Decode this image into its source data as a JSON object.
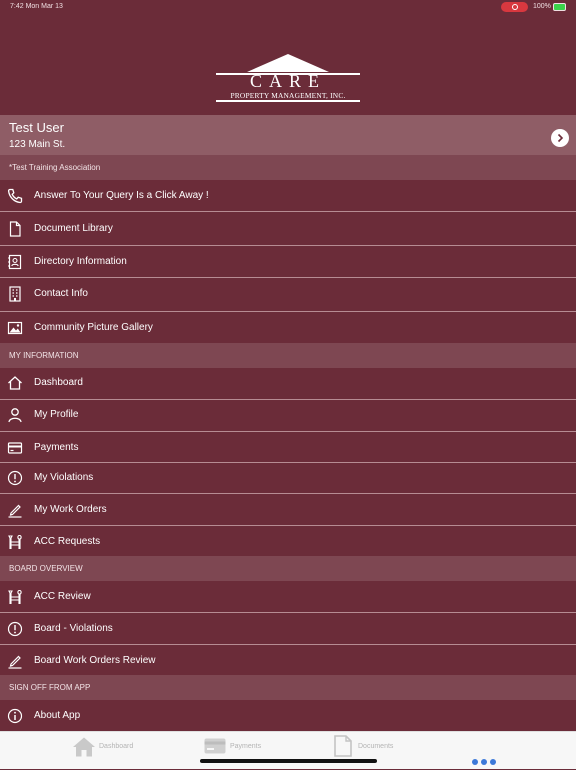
{
  "status": {
    "time": "7:42  Mon Mar 13",
    "battery": "100%"
  },
  "logo": {
    "title": "CARE",
    "subtitle": "PROPERTY MANAGEMENT, INC."
  },
  "user": {
    "name": "Test User",
    "address": "123 Main St."
  },
  "association": "*Test Training Association",
  "menu_top": [
    {
      "label": "Answer To Your Query Is a Click Away !",
      "icon": "phone-icon"
    },
    {
      "label": "Document Library",
      "icon": "document-icon"
    },
    {
      "label": "Directory Information",
      "icon": "contact-card-icon"
    },
    {
      "label": "Contact Info",
      "icon": "building-icon"
    },
    {
      "label": "Community Picture Gallery",
      "icon": "image-icon"
    }
  ],
  "section_my_info": "MY INFORMATION",
  "menu_my_info": [
    {
      "label": "Dashboard",
      "icon": "home-icon"
    },
    {
      "label": "My Profile",
      "icon": "person-icon"
    },
    {
      "label": "Payments",
      "icon": "card-icon"
    },
    {
      "label": "My Violations",
      "icon": "alert-circle-icon"
    },
    {
      "label": "My Work Orders",
      "icon": "pencil-sign-icon"
    },
    {
      "label": "ACC Requests",
      "icon": "tools-icon"
    }
  ],
  "section_board": "BOARD OVERVIEW",
  "menu_board": [
    {
      "label": "ACC Review",
      "icon": "tools-icon"
    },
    {
      "label": "Board - Violations",
      "icon": "alert-circle-icon"
    },
    {
      "label": "Board Work Orders Review",
      "icon": "pencil-sign-icon"
    }
  ],
  "section_signoff": "SIGN OFF FROM APP",
  "menu_signoff": [
    {
      "label": "About App",
      "icon": "info-icon"
    }
  ],
  "tabbar": {
    "dashboard": "Dashboard",
    "payments": "Payments",
    "documents": "Documents"
  }
}
